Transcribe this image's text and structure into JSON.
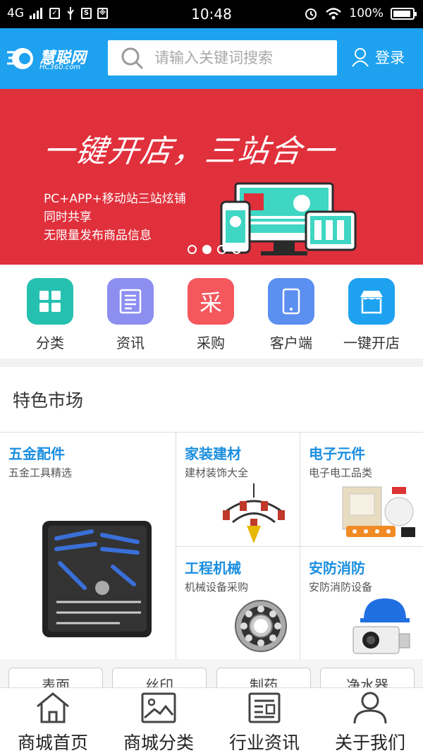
{
  "status_bar": {
    "network": "4G",
    "time": "10:48",
    "battery": "100%"
  },
  "header": {
    "logo_name": "慧聪网",
    "logo_sub": "HC360.com",
    "search_placeholder": "请输入关键词搜索",
    "login_label": "登录",
    "accent_color": "#1ea2f0"
  },
  "banner": {
    "slogan": "一键开店，三站合一",
    "lines": [
      "PC+APP+移动站三站炫铺",
      "同时共享",
      "无限量发布商品信息"
    ],
    "active_dot": 1,
    "dot_count": 4
  },
  "quick_nav": [
    {
      "label": "分类",
      "icon": "grid-icon",
      "color": "#26c0b0"
    },
    {
      "label": "资讯",
      "icon": "news-icon",
      "color": "#8c8ef0"
    },
    {
      "label": "采购",
      "icon": "purchase-icon",
      "glyph": "采",
      "color": "#f4575c"
    },
    {
      "label": "客户端",
      "icon": "phone-icon",
      "color": "#5b8ff0"
    },
    {
      "label": "一键开店",
      "icon": "store-icon",
      "color": "#1ea2f0"
    }
  ],
  "featured": {
    "title": "特色市场",
    "markets": [
      {
        "title": "五金配件",
        "subtitle": "五金工具精选",
        "image": "toolbox-image"
      },
      {
        "title": "家装建材",
        "subtitle": "建材装饰大全",
        "image": "chandelier-image"
      },
      {
        "title": "电子元件",
        "subtitle": "电子电工品类",
        "image": "electronics-image"
      },
      {
        "title": "工程机械",
        "subtitle": "机械设备采购",
        "image": "bearing-image"
      },
      {
        "title": "安防消防",
        "subtitle": "安防消防设备",
        "image": "security-camera-image"
      }
    ]
  },
  "tags": [
    "表面",
    "丝印",
    "制药",
    "净水器"
  ],
  "bottom_nav": [
    {
      "label": "商城首页",
      "icon": "home-icon"
    },
    {
      "label": "商城分类",
      "icon": "image-icon"
    },
    {
      "label": "行业资讯",
      "icon": "news-icon"
    },
    {
      "label": "关于我们",
      "icon": "person-icon"
    }
  ]
}
